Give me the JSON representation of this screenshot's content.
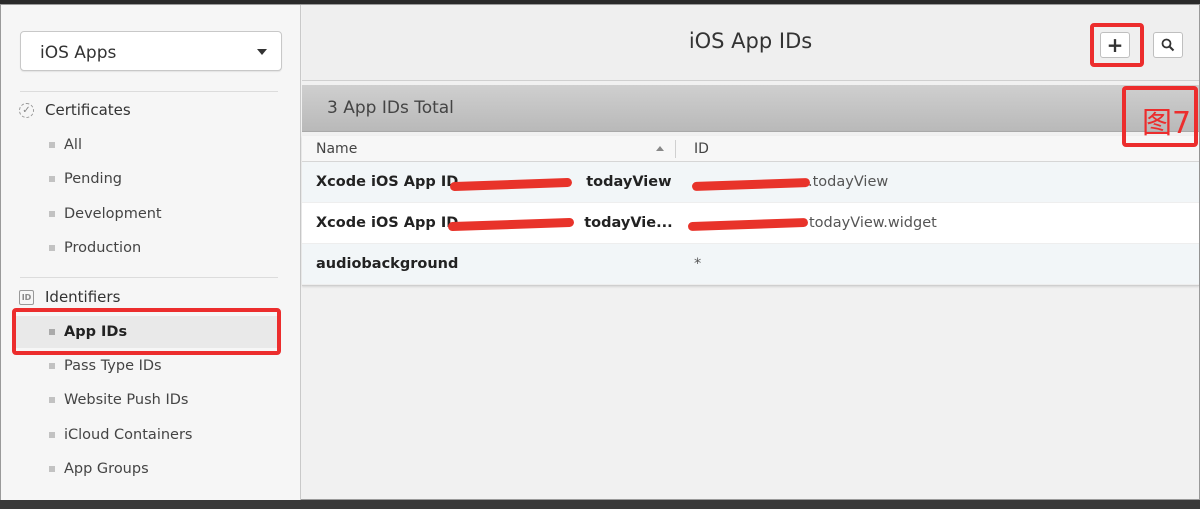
{
  "sidebar": {
    "app_selector": "iOS Apps",
    "sections": [
      {
        "title": "Certificates",
        "icon": "certificate-icon",
        "items": [
          "All",
          "Pending",
          "Development",
          "Production"
        ]
      },
      {
        "title": "Identifiers",
        "icon": "id-icon",
        "items": [
          "App IDs",
          "Pass Type IDs",
          "Website Push IDs",
          "iCloud Containers",
          "App Groups"
        ]
      }
    ],
    "active_item": "App IDs"
  },
  "header": {
    "title": "iOS App IDs",
    "add_label": "+",
    "search_icon": "search-icon"
  },
  "list": {
    "total_label": "3 App IDs Total",
    "columns": [
      "Name",
      "ID"
    ],
    "rows": [
      {
        "name_prefix": "Xcode iOS App ID",
        "name_suffix": "todayView",
        "id_suffix": ".todayView"
      },
      {
        "name_prefix": "Xcode iOS App ID",
        "name_suffix": "todayVie...",
        "id_suffix": "todayView.widget"
      },
      {
        "name_prefix": "audiobackground",
        "name_suffix": "",
        "id_suffix": "*"
      }
    ]
  },
  "annotation": {
    "label": "图7",
    "color": "#ec2d2d"
  }
}
